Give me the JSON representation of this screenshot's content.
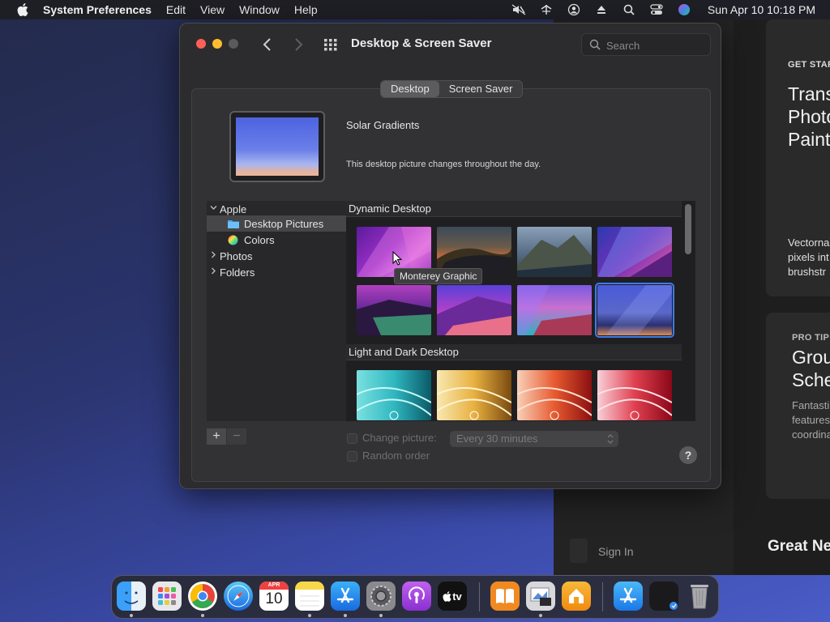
{
  "menubar": {
    "app_name": "System Preferences",
    "items": [
      "Edit",
      "View",
      "Window",
      "Help"
    ],
    "clock": "Sun Apr 10  10:18 PM"
  },
  "window": {
    "title": "Desktop & Screen Saver",
    "search_placeholder": "Search",
    "tabs": [
      {
        "label": "Desktop",
        "active": true
      },
      {
        "label": "Screen Saver",
        "active": false
      }
    ],
    "picture_name": "Solar Gradients",
    "picture_description": "This desktop picture changes throughout the day.",
    "sources": {
      "apple": "Apple",
      "desktop_pictures": "Desktop Pictures",
      "colors": "Colors",
      "photos": "Photos",
      "folders": "Folders"
    },
    "add_label": "+",
    "remove_label": "−",
    "gallery": {
      "section1": "Dynamic Desktop",
      "section2": "Light and Dark Desktop",
      "tooltip": "Monterey Graphic"
    },
    "options": {
      "change_picture": "Change picture:",
      "interval": "Every 30 minutes",
      "random_order": "Random order"
    },
    "help": "?"
  },
  "bgapp": {
    "card1_kicker": "GET STAR",
    "card1_title": "Trans\nPhoto\nPaint",
    "card1_body": "Vectorna\npixels int\nbrushstr",
    "card2_kicker": "PRO TIP",
    "card2_title": "Grou\nSche",
    "card2_body": "Fantasti\nfeatures\ncoordina",
    "sign_in": "Sign In",
    "great_news": "Great Ne"
  },
  "dock": {
    "calendar_month": "APR",
    "calendar_day": "10",
    "tv_label": "tv"
  },
  "colors": {
    "selection_blue": "#3d7bea",
    "close_red": "#ff5f57",
    "minimize_yellow": "#febc2e"
  }
}
